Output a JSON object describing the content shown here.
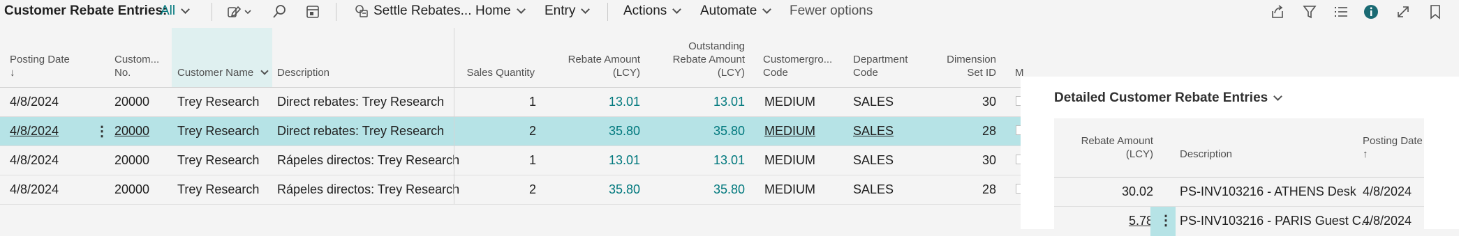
{
  "toolbar": {
    "title": "Customer Rebate Entries:",
    "filter": "All",
    "settle": "Settle Rebates...",
    "home": "Home",
    "entry": "Entry",
    "actions": "Actions",
    "automate": "Automate",
    "fewer": "Fewer options"
  },
  "grid": {
    "headers": {
      "posting_date": "Posting Date",
      "posting_sort": "↓",
      "customer_no_1": "Custom...",
      "customer_no_2": "No.",
      "customer_name": "Customer Name",
      "description": "Description",
      "sales_quantity": "Sales Quantity",
      "rebate_amount_1": "Rebate Amount",
      "rebate_amount_2": "(LCY)",
      "outstanding_1": "Outstanding",
      "outstanding_2": "Rebate Amount",
      "outstanding_3": "(LCY)",
      "custgroup_1": "Customergro...",
      "custgroup_2": "Code",
      "department_1": "Department",
      "department_2": "Code",
      "dimension_1": "Dimension",
      "dimension_2": "Set ID",
      "more": "M"
    },
    "rows": [
      {
        "date": "4/8/2024",
        "no": "20000",
        "name": "Trey Research",
        "desc": "Direct rebates: Trey Research",
        "qty": "1",
        "rebate": "13.01",
        "outstanding": "13.01",
        "group": "MEDIUM",
        "dept": "SALES",
        "dim": "30"
      },
      {
        "date": "4/8/2024",
        "no": "20000",
        "name": "Trey Research",
        "desc": "Direct rebates: Trey Research",
        "qty": "2",
        "rebate": "35.80",
        "outstanding": "35.80",
        "group": "MEDIUM",
        "dept": "SALES",
        "dim": "28"
      },
      {
        "date": "4/8/2024",
        "no": "20000",
        "name": "Trey Research",
        "desc": "Rápeles directos: Trey Research",
        "qty": "1",
        "rebate": "13.01",
        "outstanding": "13.01",
        "group": "MEDIUM",
        "dept": "SALES",
        "dim": "30"
      },
      {
        "date": "4/8/2024",
        "no": "20000",
        "name": "Trey Research",
        "desc": "Rápeles directos: Trey Research",
        "qty": "2",
        "rebate": "35.80",
        "outstanding": "35.80",
        "group": "MEDIUM",
        "dept": "SALES",
        "dim": "28"
      }
    ]
  },
  "factbox": {
    "title": "Detailed Customer Rebate Entries",
    "headers": {
      "rebate_1": "Rebate Amount",
      "rebate_2": "(LCY)",
      "description": "Description",
      "posting_date": "Posting Date",
      "posting_sort": "↑"
    },
    "rows": [
      {
        "rebate": "30.02",
        "desc": "PS-INV103216 - ATHENS Desk",
        "date": "4/8/2024"
      },
      {
        "rebate": "5.78",
        "desc": "PS-INV103216 - PARIS Guest C...",
        "date": "4/8/2024"
      }
    ]
  }
}
